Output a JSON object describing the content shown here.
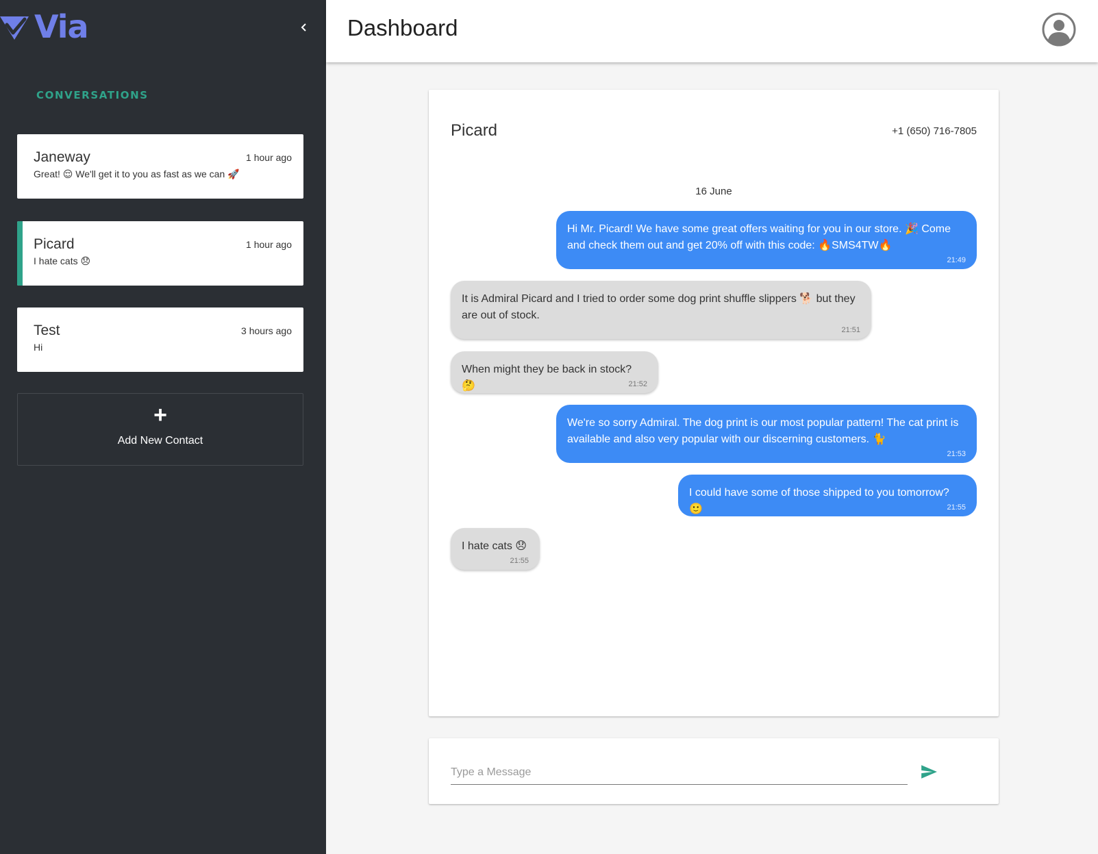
{
  "app": {
    "name": "Via",
    "brand_color": "#6f7fe8",
    "accent_color": "#2fa38a",
    "outgoing_color": "#3d8bf5",
    "incoming_color": "#dcdcdc"
  },
  "sidebar": {
    "section_title": "CONVERSATIONS",
    "conversations": [
      {
        "name": "Janeway",
        "time": "1 hour ago",
        "preview": "Great! 😌 We'll get it to you as fast as we can 🚀",
        "active": false
      },
      {
        "name": "Picard",
        "time": "1 hour ago",
        "preview": "I hate cats 😞",
        "active": true
      },
      {
        "name": "Test",
        "time": "3 hours ago",
        "preview": "Hi",
        "active": false
      }
    ],
    "add_contact": {
      "icon": "+",
      "label": "Add New Contact"
    }
  },
  "header": {
    "title": "Dashboard"
  },
  "chat": {
    "contact_name": "Picard",
    "contact_phone": "+1 (650) 716-7805",
    "date_separator": "16 June",
    "messages": [
      {
        "direction": "outgoing",
        "text": "Hi Mr. Picard! We have some great offers waiting for you in our store. 🎉 Come and check them out and get 20% off with this code: 🔥SMS4TW🔥",
        "time": "21:49"
      },
      {
        "direction": "incoming",
        "text": "It is Admiral Picard and I tried to order some dog print shuffle slippers 🐕 but they are out of stock.",
        "time": "21:51"
      },
      {
        "direction": "incoming",
        "text": "When might they be back in stock? 🤔",
        "time": "21:52"
      },
      {
        "direction": "outgoing",
        "text": "We're so sorry Admiral. The dog print is our most popular pattern! The cat print is available and also very popular with our discerning customers. 🐈",
        "time": "21:53"
      },
      {
        "direction": "outgoing",
        "text": "I could have some of those shipped to you tomorrow? 🙂",
        "time": "21:55"
      },
      {
        "direction": "incoming",
        "text": "I hate cats 😞",
        "time": "21:55"
      }
    ]
  },
  "composer": {
    "placeholder": "Type a Message",
    "value": "",
    "send_icon": "send-icon"
  }
}
